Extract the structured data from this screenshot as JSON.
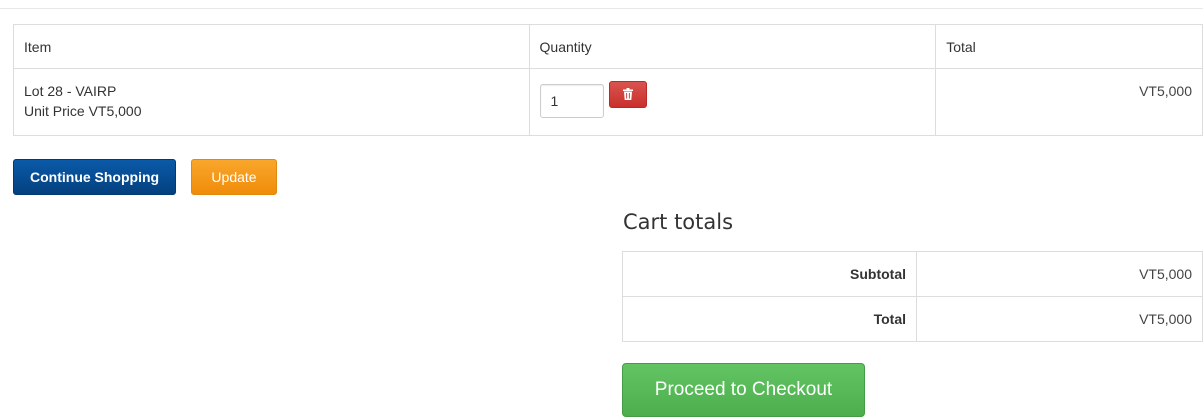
{
  "cart": {
    "headers": {
      "item": "Item",
      "quantity": "Quantity",
      "total": "Total"
    },
    "rows": [
      {
        "name": "Lot 28 - VAIRP",
        "unit_price": "Unit Price VT5,000",
        "quantity": "1",
        "total": "VT5,000"
      }
    ]
  },
  "actions": {
    "continue_label": "Continue Shopping",
    "update_label": "Update"
  },
  "totals": {
    "title": "Cart totals",
    "subtotal_label": "Subtotal",
    "subtotal_value": "VT5,000",
    "total_label": "Total",
    "total_value": "VT5,000"
  },
  "checkout": {
    "label": "Proceed to Checkout"
  },
  "icons": {
    "remove": "trash-icon"
  },
  "colors": {
    "continue": "#04407f",
    "update": "#f39a1c",
    "remove": "#d9534f",
    "checkout": "#5cb85c"
  }
}
